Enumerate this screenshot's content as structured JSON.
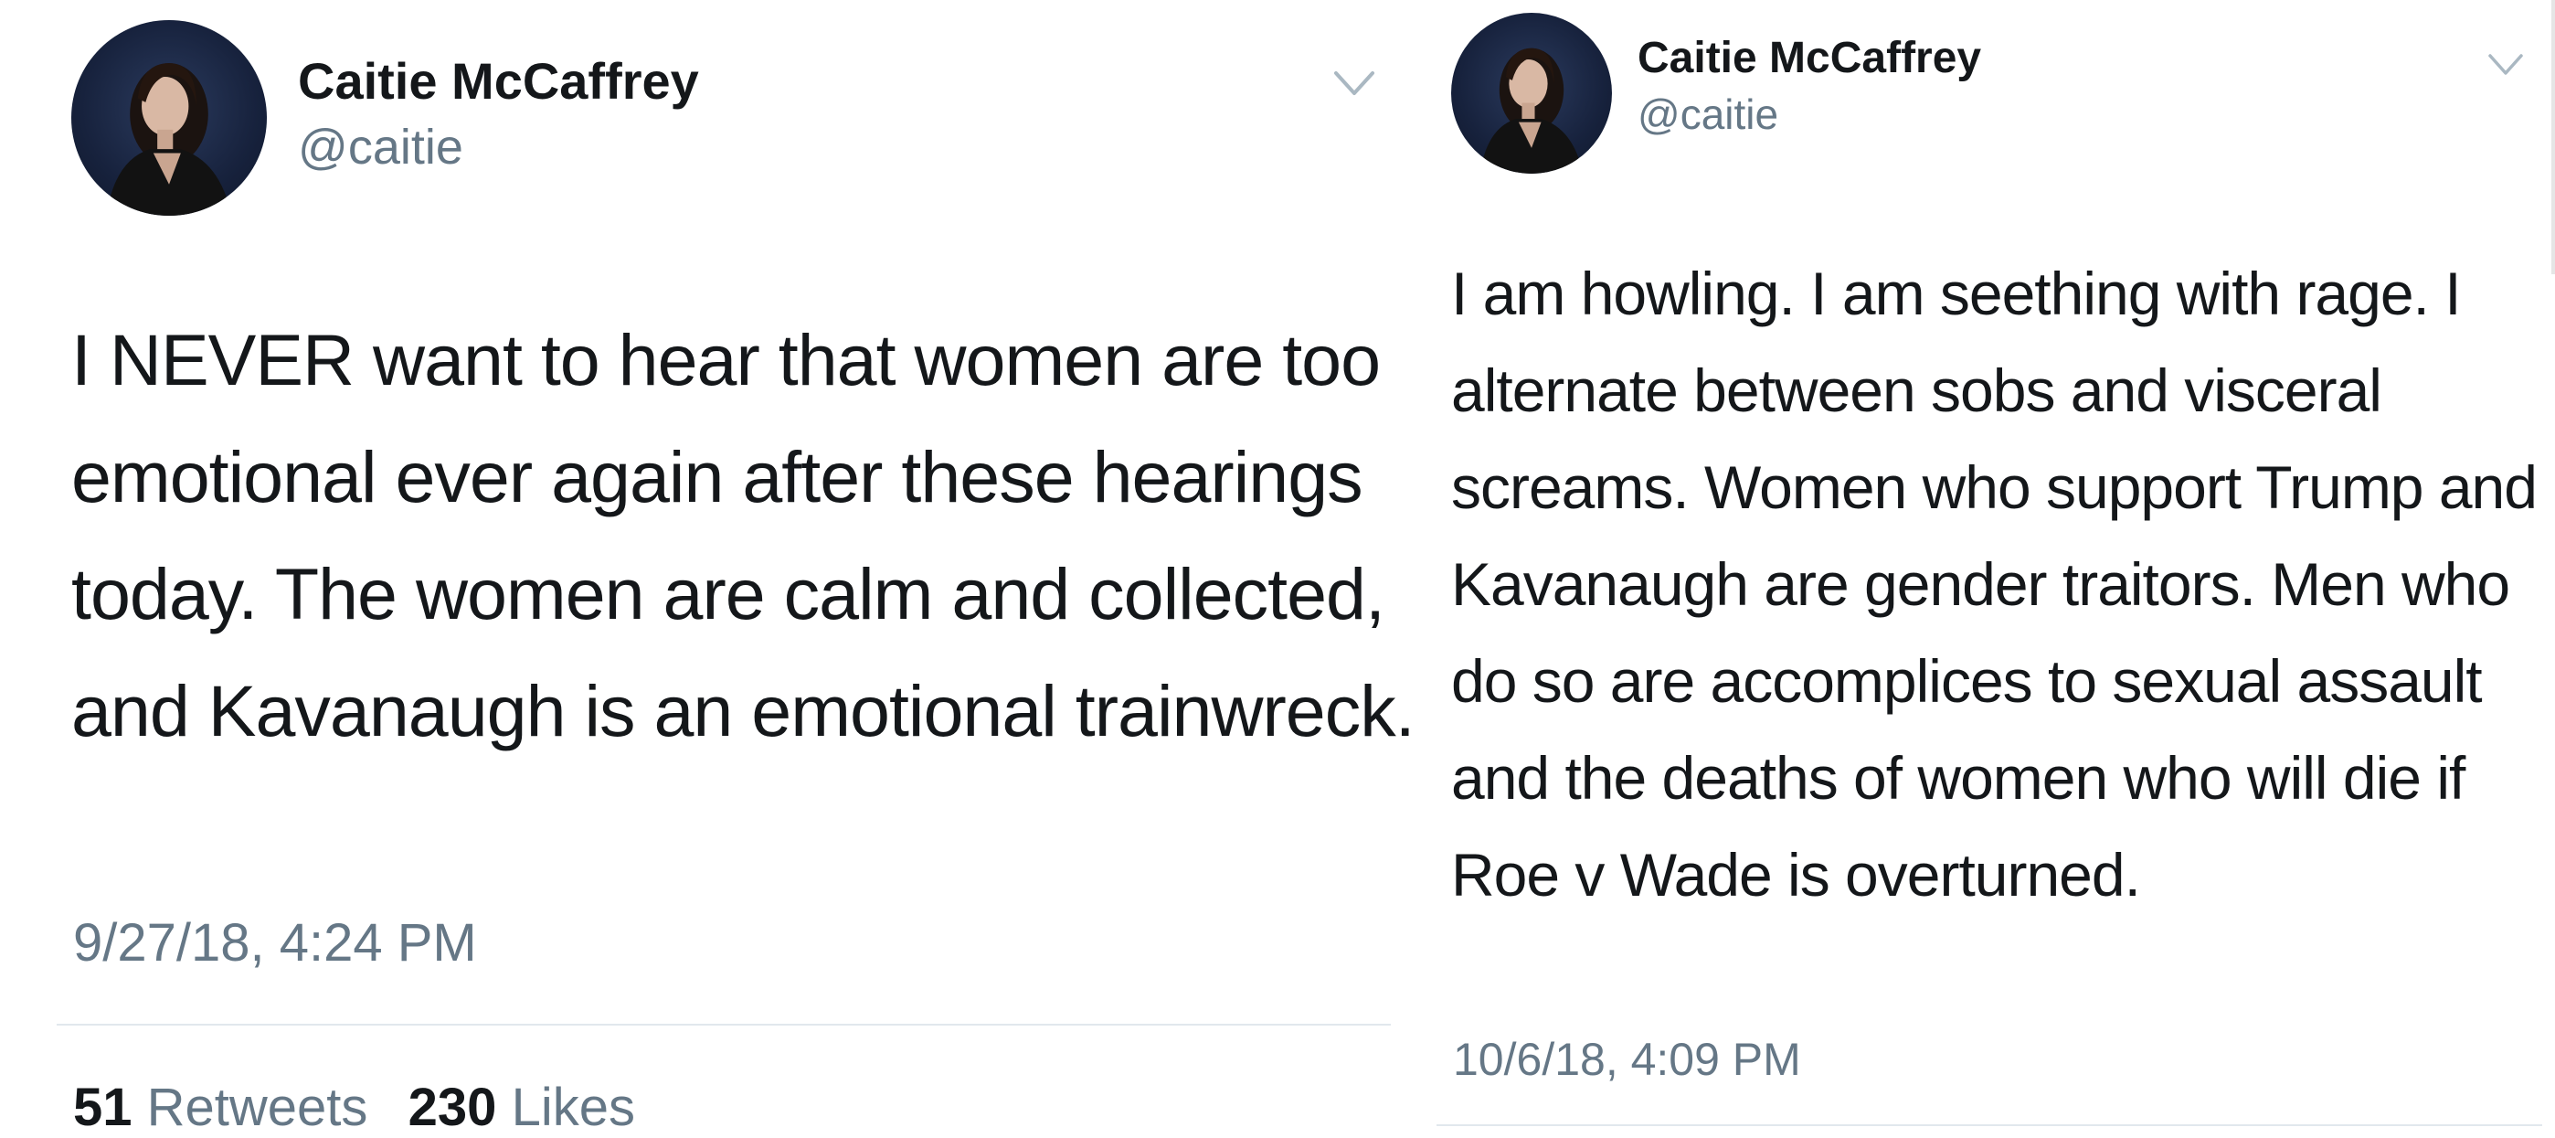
{
  "tweets": [
    {
      "display_name": "Caitie McCaffrey",
      "handle": "@caitie",
      "text": "I NEVER want to hear that women are too emotional ever again after these hearings today.  The women are calm and collected, and Kavanaugh is an emotional trainwreck.",
      "timestamp": "9/27/18, 4:24 PM",
      "retweets_count": "51",
      "retweets_label": "Retweets",
      "likes_count": "230",
      "likes_label": "Likes",
      "menu_icon": "chevron-down-icon",
      "avatar_icon": "avatar"
    },
    {
      "display_name": "Caitie McCaffrey",
      "handle": "@caitie",
      "text": "I am howling.  I am seething with rage. I alternate between sobs and visceral screams.  Women who support Trump and Kavanaugh are gender traitors. Men who do so are accomplices to sexual assault and the deaths of women who will die if Roe v Wade is overturned.",
      "timestamp": "10/6/18, 4:09 PM",
      "menu_icon": "chevron-down-icon",
      "avatar_icon": "avatar"
    }
  ],
  "colors": {
    "text_primary": "#14171a",
    "text_secondary": "#657786",
    "divider": "#e1e8ed",
    "chevron": "#aab8c2",
    "avatar_background": "#17223d"
  }
}
